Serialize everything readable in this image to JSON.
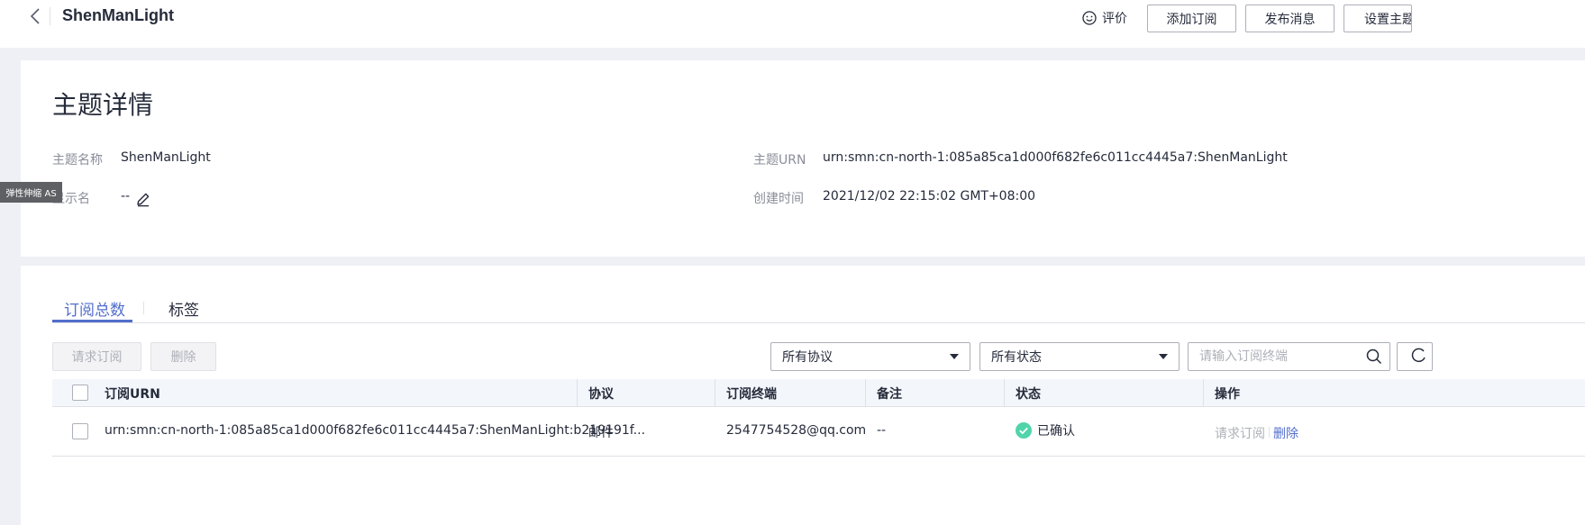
{
  "header": {
    "title": "ShenManLight",
    "rate_label": "评价",
    "buttons": {
      "add_subscription": "添加订阅",
      "publish_message": "发布消息",
      "set_topic": "设置主题"
    }
  },
  "detail": {
    "section_title": "主题详情",
    "topic_name_label": "主题名称",
    "topic_name_value": "ShenManLight",
    "display_name_label": "显示名",
    "display_name_value": "--",
    "topic_urn_label": "主题URN",
    "topic_urn_value": "urn:smn:cn-north-1:085a85ca1d000f682fe6c011cc4445a7:ShenManLight",
    "created_label": "创建时间",
    "created_value": "2021/12/02 22:15:02 GMT+08:00"
  },
  "overlay": {
    "as_tag": "弹性伸缩 AS"
  },
  "subscriptions": {
    "tabs": [
      "订阅总数",
      "标签"
    ],
    "request_button": "请求订阅",
    "delete_button": "删除",
    "protocol_select": "所有协议",
    "status_select": "所有状态",
    "search_placeholder": "请输入订阅终端",
    "columns": [
      "订阅URN",
      "协议",
      "订阅终端",
      "备注",
      "状态",
      "操作"
    ],
    "rows": [
      {
        "urn": "urn:smn:cn-north-1:085a85ca1d000f682fe6c011cc4445a7:ShenManLight:b219191f...",
        "protocol": "邮件",
        "endpoint": "2547754528@qq.com",
        "remark": "--",
        "status": "已确认",
        "op_request": "请求订阅",
        "op_delete": "删除"
      }
    ]
  },
  "colors": {
    "accent": "#526ecc",
    "success": "#50d4ab"
  }
}
